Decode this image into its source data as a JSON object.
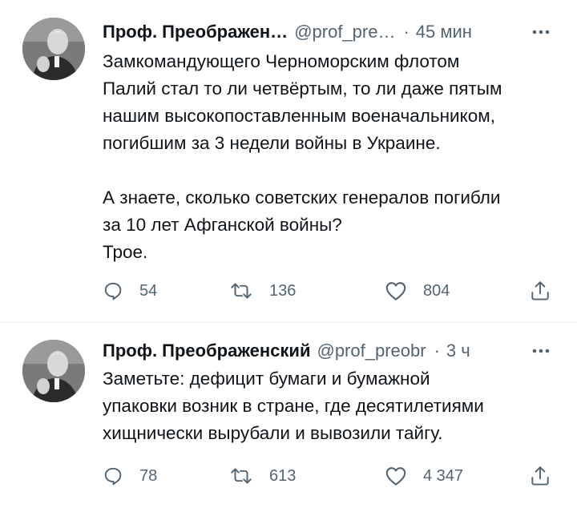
{
  "tweets": [
    {
      "author_name": "Проф. Преображен…",
      "handle": "@prof_pre…",
      "separator": "·",
      "time": "45 мин",
      "more_icon": "ellipsis-icon",
      "text": "Замкомандующего Черноморским флотом\nПалий стал то ли четвёртым, то ли даже пятым\nнашим высокопоставленным военачальником,\nпогибшим за 3 недели войны в Украине.\n\nА знаете, сколько советских генералов погибли\nза 10 лет Афганской войны?\nТрое.",
      "replies": "54",
      "retweets": "136",
      "likes": "804"
    },
    {
      "author_name": "Проф. Преображенский",
      "handle": "@prof_preobr",
      "separator": "·",
      "time": "3 ч",
      "more_icon": "ellipsis-icon",
      "text": "Заметьте: дефицит бумаги и бумажной\nупаковки возник в стране, где десятилетиями\nхищнически вырубали и вывозили тайгу.",
      "replies": "78",
      "retweets": "613",
      "likes": "4 347"
    }
  ],
  "colors": {
    "text_primary": "#0f1419",
    "text_secondary": "#536471",
    "divider": "#eff3f4"
  },
  "icons": [
    "reply-icon",
    "retweet-icon",
    "like-icon",
    "share-icon",
    "ellipsis-icon"
  ]
}
